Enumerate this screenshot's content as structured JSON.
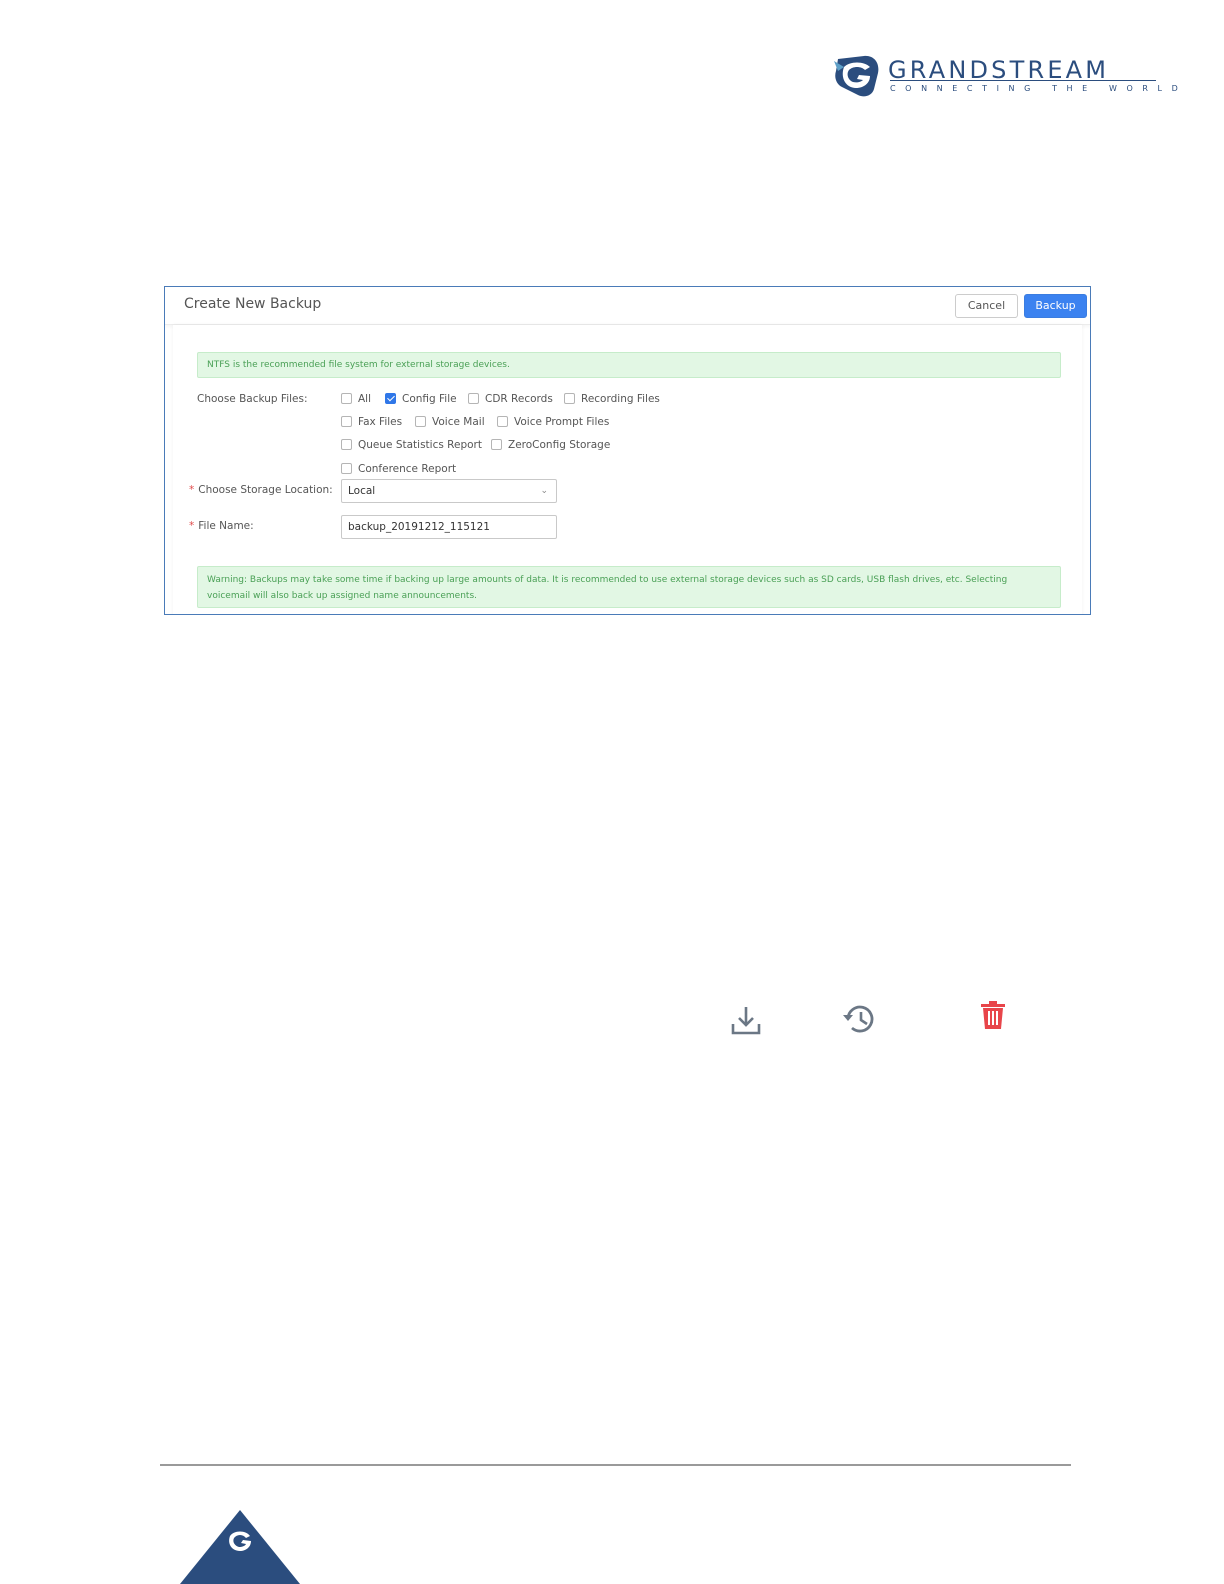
{
  "brand": {
    "name": "GRANDSTREAM",
    "tagline": "CONNECTING THE WORLD",
    "color": "#2b4d7e"
  },
  "dialog": {
    "title": "Create New Backup",
    "cancel_label": "Cancel",
    "backup_label": "Backup",
    "notice_top": "NTFS is the recommended file system for external storage devices.",
    "choose_files_label": "Choose Backup Files:",
    "options": [
      {
        "label": "All",
        "checked": false
      },
      {
        "label": "Config File",
        "checked": true
      },
      {
        "label": "CDR Records",
        "checked": false
      },
      {
        "label": "Recording Files",
        "checked": false
      },
      {
        "label": "Fax Files",
        "checked": false
      },
      {
        "label": "Voice Mail",
        "checked": false
      },
      {
        "label": "Voice Prompt Files",
        "checked": false
      },
      {
        "label": "Queue Statistics Report",
        "checked": false
      },
      {
        "label": "ZeroConfig Storage",
        "checked": false
      },
      {
        "label": "Conference Report",
        "checked": false
      }
    ],
    "storage_label": "Choose Storage Location:",
    "storage_value": "Local",
    "filename_label": "File Name:",
    "filename_value": "backup_20191212_115121",
    "warning": "Warning: Backups may take some time if backing up large amounts of data. It is recommended to use external storage devices such as SD cards, USB flash drives, etc. Selecting voicemail will also back up assigned name announcements."
  },
  "icons": [
    {
      "name": "download-icon",
      "color": "#6b7785"
    },
    {
      "name": "restore-history-icon",
      "color": "#6b7785"
    },
    {
      "name": "delete-icon",
      "color": "#e8454a"
    }
  ]
}
